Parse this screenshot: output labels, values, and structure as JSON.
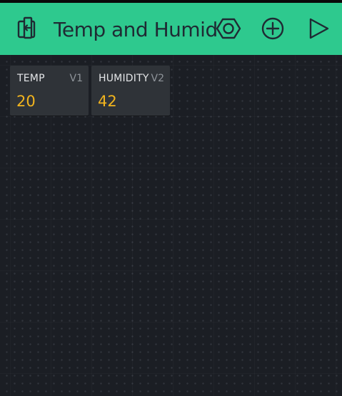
{
  "header": {
    "title": "Temp and Humid",
    "background_color": "#2ec98e",
    "icons": {
      "back": "exit-project-icon",
      "settings": "hexagon-settings-icon",
      "add": "add-widget-icon",
      "play": "play-icon"
    }
  },
  "widgets": [
    {
      "label": "TEMP",
      "pin": "V1",
      "value": "20"
    },
    {
      "label": "HUMIDITY",
      "pin": "V2",
      "value": "42"
    }
  ],
  "colors": {
    "value_text": "#f2b41e",
    "canvas": "#1b1e24",
    "widget_bg": "#2f3338"
  }
}
